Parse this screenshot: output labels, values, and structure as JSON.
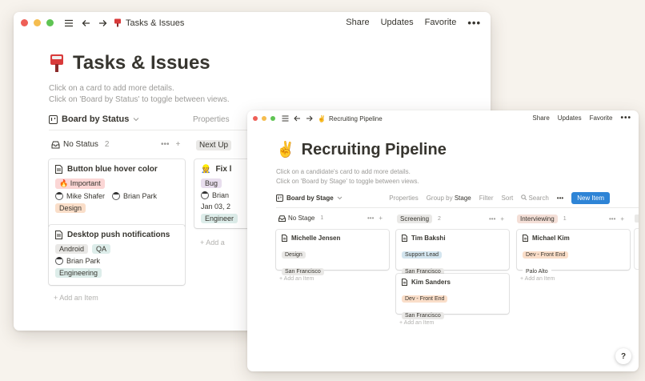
{
  "colors": {
    "traffic_red": "#ee5f57",
    "traffic_yellow": "#f5bd4f",
    "traffic_green": "#5fc453",
    "accent_blue": "#2e84d6",
    "tag_red": "#fbd6d5",
    "tag_orange": "#fadec9",
    "tag_blue": "#d3e5ef",
    "tag_teal": "#ddedea",
    "tag_gray": "#e9e8e6",
    "tag_purple": "#e8deee",
    "tag_yellow": "#fdecc8"
  },
  "back_window": {
    "breadcrumb": "Tasks & Issues",
    "breadcrumb_icon": "mailbox-icon",
    "actions": {
      "share": "Share",
      "updates": "Updates",
      "favorite": "Favorite",
      "more": "•••"
    },
    "page_title": "Tasks & Issues",
    "description": [
      "Click on a card to add more details.",
      "Click on 'Board by Status' to toggle between views."
    ],
    "view_label": "Board by Status",
    "properties": "Properties",
    "columns": [
      {
        "name": "No Status",
        "count": "2",
        "more": "•••",
        "add": "+"
      },
      {
        "name": "Next Up"
      }
    ],
    "cards": [
      {
        "title": "Button blue hover color",
        "priority": "🔥 Important",
        "people": [
          "Mike Shafer",
          "Brian Park"
        ],
        "tag": "Design"
      },
      {
        "title": "Desktop push notifications",
        "tags": [
          "Android",
          "QA"
        ],
        "people": [
          "Brian Park"
        ],
        "tag": "Engineering"
      }
    ],
    "next_card": {
      "title": "Fix l",
      "tags": [
        "Bug"
      ],
      "person": "Brian",
      "date": "Jan 03, 2",
      "tag": "Engineer"
    },
    "add_item": "+  Add an Item",
    "add_item_short": "+  Add a"
  },
  "front_window": {
    "breadcrumb": "Recruiting Pipeline",
    "breadcrumb_icon": "victory-hand-icon",
    "actions": {
      "share": "Share",
      "updates": "Updates",
      "favorite": "Favorite",
      "more": "•••"
    },
    "page_title": "Recruiting Pipeline",
    "description": [
      "Click on a candidate's card to add more details.",
      "Click on 'Board by Stage' to toggle between views."
    ],
    "view_label": "Board by Stage",
    "toolbar": {
      "properties": "Properties",
      "group_by": "Group by",
      "group_by_value": "Stage",
      "filter": "Filter",
      "sort": "Sort",
      "search": "Search",
      "more": "•••",
      "new_item": "New Item"
    },
    "columns": [
      {
        "name": "No Stage",
        "count": "1",
        "more": "•••",
        "add": "+"
      },
      {
        "name": "Screening",
        "count": "2",
        "more": "•••",
        "add": "+"
      },
      {
        "name": "Interviewing",
        "count": "1",
        "more": "•••",
        "add": "+"
      }
    ],
    "cards": {
      "michelle": {
        "name": "Michelle Jensen",
        "role": "Design",
        "location": "San Francisco"
      },
      "tim": {
        "name": "Tim Bakshi",
        "role": "Support Lead",
        "location": "San Francisco"
      },
      "kim_s": {
        "name": "Kim Sanders",
        "role": "Dev - Front End",
        "location": "San Francisco"
      },
      "michael": {
        "name": "Michael Kim",
        "role": "Dev - Front End",
        "location": "Palo Alto"
      }
    },
    "add_item": "+  Add an Item",
    "help": "?"
  }
}
